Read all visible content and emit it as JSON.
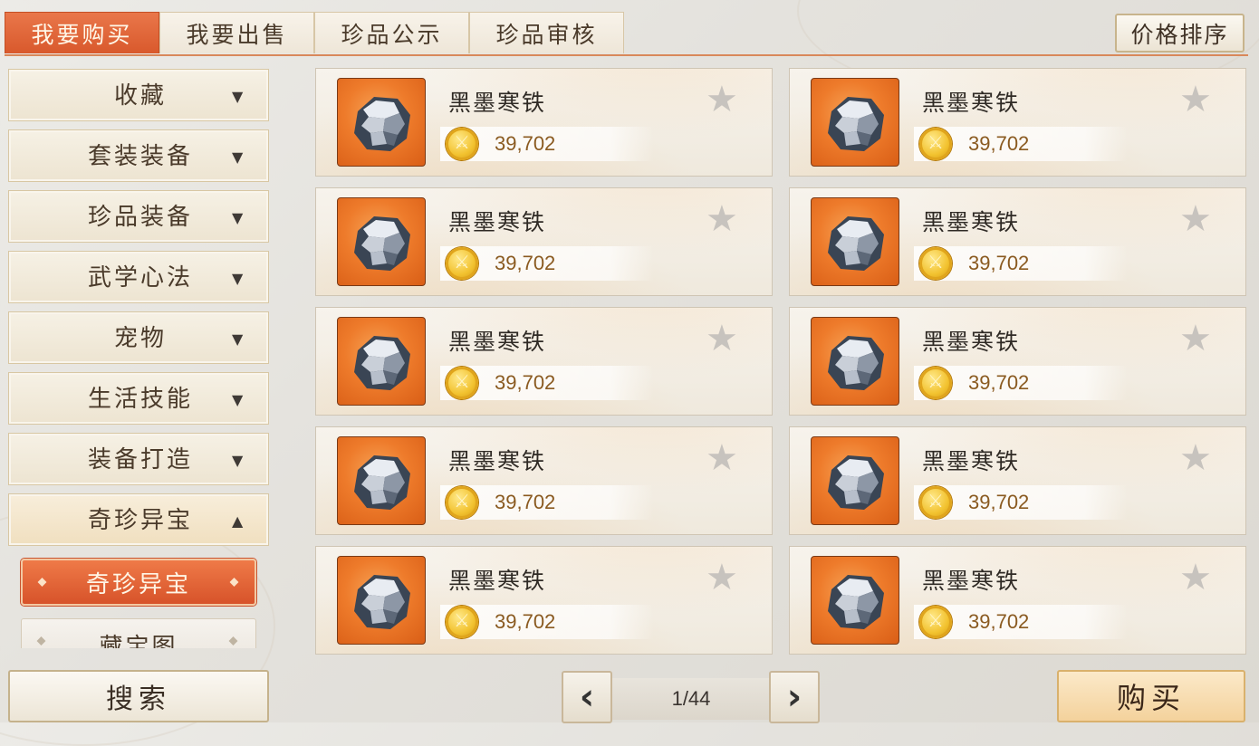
{
  "tabs": [
    {
      "label": "我要购买",
      "active": true
    },
    {
      "label": "我要出售",
      "active": false
    },
    {
      "label": "珍品公示",
      "active": false
    },
    {
      "label": "珍品审核",
      "active": false
    }
  ],
  "sort_button": "价格排序",
  "sidebar": {
    "categories": [
      {
        "label": "收藏",
        "arrow": "▼"
      },
      {
        "label": "套装装备",
        "arrow": "▼"
      },
      {
        "label": "珍品装备",
        "arrow": "▼"
      },
      {
        "label": "武学心法",
        "arrow": "▼"
      },
      {
        "label": "宠物",
        "arrow": "▼"
      },
      {
        "label": "生活技能",
        "arrow": "▼"
      },
      {
        "label": "装备打造",
        "arrow": "▼"
      },
      {
        "label": "奇珍异宝",
        "arrow": "▲",
        "expanded": true
      }
    ],
    "subcategories": [
      {
        "label": "奇珍异宝",
        "selected": true
      },
      {
        "label": "藏宝图",
        "selected": false
      }
    ]
  },
  "items": [
    {
      "name": "黑墨寒铁",
      "price": "39,702",
      "icon": "black-iron-ore-icon"
    },
    {
      "name": "黑墨寒铁",
      "price": "39,702",
      "icon": "black-iron-ore-icon"
    },
    {
      "name": "黑墨寒铁",
      "price": "39,702",
      "icon": "black-iron-ore-icon"
    },
    {
      "name": "黑墨寒铁",
      "price": "39,702",
      "icon": "black-iron-ore-icon"
    },
    {
      "name": "黑墨寒铁",
      "price": "39,702",
      "icon": "black-iron-ore-icon"
    },
    {
      "name": "黑墨寒铁",
      "price": "39,702",
      "icon": "black-iron-ore-icon"
    },
    {
      "name": "黑墨寒铁",
      "price": "39,702",
      "icon": "black-iron-ore-icon"
    },
    {
      "name": "黑墨寒铁",
      "price": "39,702",
      "icon": "black-iron-ore-icon"
    },
    {
      "name": "黑墨寒铁",
      "price": "39,702",
      "icon": "black-iron-ore-icon"
    },
    {
      "name": "黑墨寒铁",
      "price": "39,702",
      "icon": "black-iron-ore-icon"
    }
  ],
  "search_button": "搜索",
  "pagination": {
    "page_text": "1/44",
    "prev": "‹",
    "next": "›"
  },
  "buy_button": "购买",
  "colors": {
    "accent": "#e2653a",
    "price_text": "#8a5a20",
    "star_inactive": "#c7c3be"
  }
}
